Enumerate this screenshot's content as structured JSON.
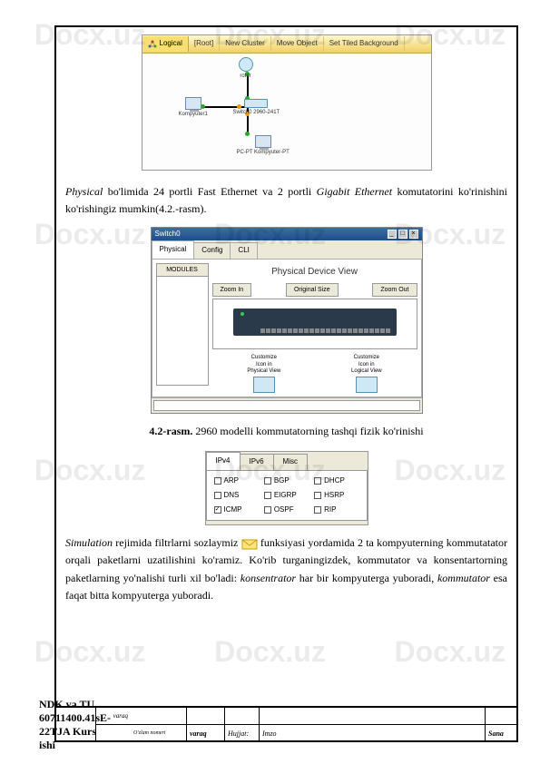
{
  "watermark": "Docx.uz",
  "fig1": {
    "toolbar": {
      "logical": "Logical",
      "root": "[Root]",
      "newcluster": "New Cluster",
      "moveobject": "Move Object",
      "setbg": "Set Tiled Background"
    },
    "devices": {
      "router": "roter",
      "pc1": "Kompyuter1",
      "switch": "Switch0 2960-241T",
      "pc2": "PC-PT Kompyuter-PT"
    }
  },
  "para1_a": "Physical",
  "para1_b": " bo'limida 24 portli Fast Ethernet va 2 portli ",
  "para1_c": "Gigabit Ethernet",
  "para1_d": " komutatorini ko'rinishini ko'rishingiz mumkin(4.2.-rasm).",
  "fig2": {
    "title": "Switch0",
    "tabs": {
      "physical": "Physical",
      "config": "Config",
      "cli": "CLI"
    },
    "modules": "MODULES",
    "pdv": "Physical Device View",
    "zoom": {
      "in": "Zoom In",
      "orig": "Original Size",
      "out": "Zoom Out"
    },
    "custom1a": "Customize",
    "custom1b": "Icon in",
    "custom1c": "Physical View",
    "custom2a": "Customize",
    "custom2b": "Icon in",
    "custom2c": "Logical View"
  },
  "caption_b": "4.2-rasm.",
  "caption_t": "  2960 modelli kommutatorning tashqi fizik ko'rinishi",
  "fig3": {
    "tabs": {
      "ipv4": "IPv4",
      "ipv6": "IPv6",
      "misc": "Misc"
    },
    "opts": {
      "arp": "ARP",
      "bgp": "BGP",
      "dhcp": "DHCP",
      "dns": "DNS",
      "eigrp": "EIGRP",
      "hsrp": "HSRP",
      "icmp": "ICMP",
      "ospf": "OSPF",
      "rip": "RIP"
    }
  },
  "para2_a": "Simulation",
  "para2_b": " rejimida filtrlarni sozlaymiz ",
  "para2_c": " funksiyasi yordamida 2 ta kompyuterning kommutatator orqali paketlarni uzatilishini ko'ramiz. Ko'rib turganingizdek, kommutator va konsentartorning paketlarning yo'nalishi turli xil bo'ladi: ",
  "para2_d": "konsentrator",
  "para2_e": " har bir kompyuterga yuboradi, ",
  "para2_f": "kommutator",
  "para2_g": " esa faqat bitta kompyuterga yuboradi.",
  "footer": {
    "ozlam": "O'zlam nomeri",
    "varaq": "varaq",
    "hujjat": "Hujjat:",
    "imzo": "Imzo",
    "sana": "Sana",
    "title": "NDK va TU  60711400.41sE-22TJA Kurs ishi",
    "varaq_lbl": "varaq"
  }
}
